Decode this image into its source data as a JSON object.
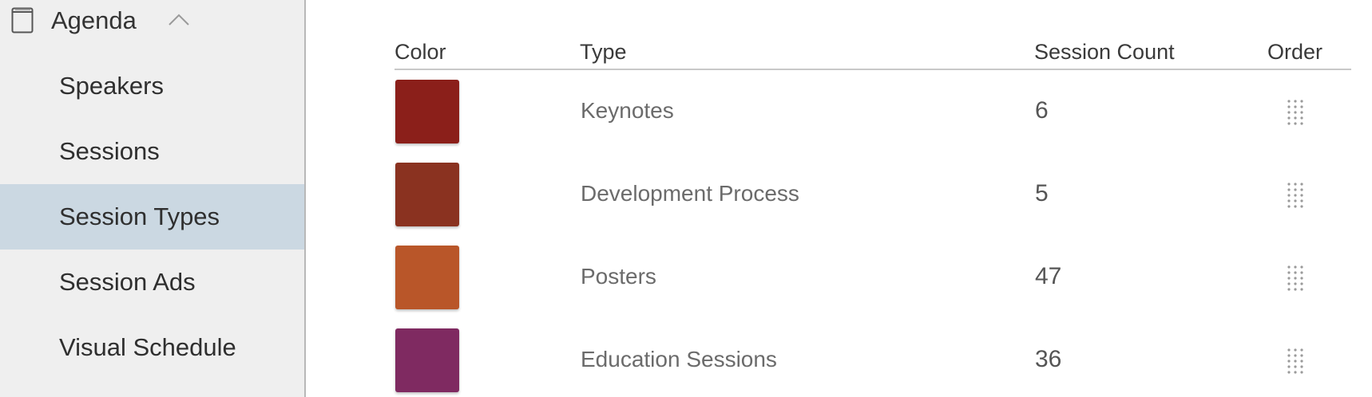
{
  "sidebar": {
    "section_title": "Agenda",
    "section_icon": "book-icon",
    "collapse_icon": "chevron-up-icon",
    "items": [
      {
        "label": "Speakers",
        "active": false
      },
      {
        "label": "Sessions",
        "active": false
      },
      {
        "label": "Session Types",
        "active": true
      },
      {
        "label": "Session Ads",
        "active": false
      },
      {
        "label": "Visual Schedule",
        "active": false
      }
    ]
  },
  "table": {
    "headers": {
      "color": "Color",
      "type": "Type",
      "session_count": "Session Count",
      "order": "Order"
    },
    "rows": [
      {
        "color": "#8b1f1a",
        "type": "Keynotes",
        "session_count": "6",
        "order_icon": "drag-handle-icon"
      },
      {
        "color": "#8a3220",
        "type": "Development Process",
        "session_count": "5",
        "order_icon": "drag-handle-icon"
      },
      {
        "color": "#b95629",
        "type": "Posters",
        "session_count": "47",
        "order_icon": "drag-handle-icon"
      },
      {
        "color": "#7f2a61",
        "type": "Education Sessions",
        "session_count": "36",
        "order_icon": "drag-handle-icon"
      }
    ]
  },
  "colors": {
    "sidebar_bg": "#efefef",
    "active_item_bg": "#cbd8e2"
  }
}
